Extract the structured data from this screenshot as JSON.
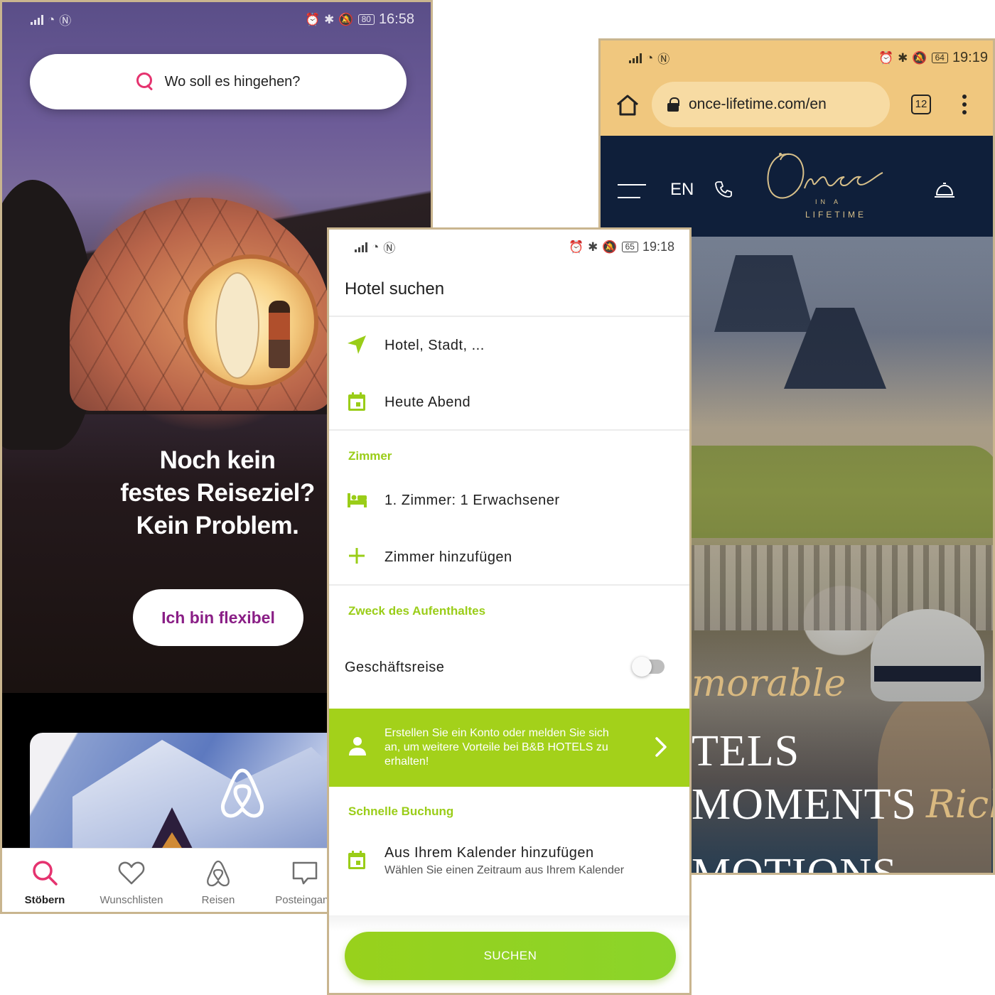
{
  "airbnb": {
    "status": {
      "time": "16:58",
      "battery": "80"
    },
    "search_placeholder": "Wo soll es hingehen?",
    "headline": [
      "Noch kein",
      "festes Reiseziel?",
      "Kein Problem."
    ],
    "flex_button": "Ich bin flexibel",
    "tabs": [
      {
        "label": "Stöbern",
        "icon": "search-icon",
        "active": true
      },
      {
        "label": "Wunschlisten",
        "icon": "heart-icon",
        "active": false
      },
      {
        "label": "Reisen",
        "icon": "airbnb-logo-icon",
        "active": false
      },
      {
        "label": "Posteingang",
        "icon": "message-icon",
        "active": false
      }
    ],
    "accent_color": "#e5336f",
    "button_text_color": "#8a1f86"
  },
  "bb_hotels": {
    "status": {
      "time": "19:18",
      "battery": "65"
    },
    "title": "Hotel suchen",
    "destination_placeholder": "Hotel, Stadt, ...",
    "date_value": "Heute Abend",
    "rooms_section": "Zimmer",
    "room_summary": "1. Zimmer: 1 Erwachsener",
    "add_room": "Zimmer hinzufügen",
    "purpose_section": "Zweck des Aufenthaltes",
    "business_trip": "Geschäftsreise",
    "business_trip_enabled": false,
    "promo": "Erstellen Sie ein Konto oder melden Sie sich an, um weitere Vorteile bei B&B HOTELS zu erhalten!",
    "quick_section": "Schnelle Buchung",
    "calendar_title": "Aus Ihrem Kalender hinzufügen",
    "calendar_sub": "Wählen Sie einen Zeitraum aus Ihrem Kalender",
    "search_button": "SUCHEN",
    "accent_color": "#a3d11a"
  },
  "once": {
    "status": {
      "time": "19:19",
      "battery": "64"
    },
    "url": "once-lifetime.com/en",
    "tab_count": "12",
    "language": "EN",
    "brand_sub1": "IN A",
    "brand_sub2": "LIFETIME",
    "hero": {
      "script1": "morable",
      "line1": "TELS",
      "line2": "MOMENTS",
      "script2": "Rich",
      "line3": "MOTIONS"
    },
    "chrome_color": "#f0c77e",
    "nav_color": "#0f1f3a",
    "gold_color": "#d9b980"
  }
}
